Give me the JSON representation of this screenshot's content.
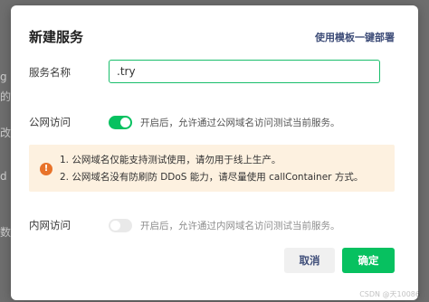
{
  "dialog": {
    "title": "新建服务",
    "template_link": "使用模板一键部署",
    "service_name": {
      "label": "服务名称",
      "value": ".try"
    },
    "public_access": {
      "label": "公网访问",
      "enabled": true,
      "hint": "开启后，允许通过公网域名访问测试当前服务。"
    },
    "warning": {
      "lines": [
        "1. 公网域名仅能支持测试使用，请勿用于线上生产。",
        "2. 公网域名没有防刷防 DDoS 能力，请尽量使用 callContainer 方式。"
      ]
    },
    "private_access": {
      "label": "内网访问",
      "enabled": false,
      "hint": "开启后，允许通过内网域名访问测试当前服务。"
    },
    "buttons": {
      "cancel": "取消",
      "confirm": "确定"
    }
  },
  "background_fragments": [
    "g",
    "的",
    "改",
    "d",
    "数"
  ],
  "watermark": "CSDN @天10086",
  "colors": {
    "accent_green": "#07c160",
    "link_blue": "#3d4c78",
    "warning_bg": "#fdf1e0",
    "warning_icon": "#e8732a"
  }
}
